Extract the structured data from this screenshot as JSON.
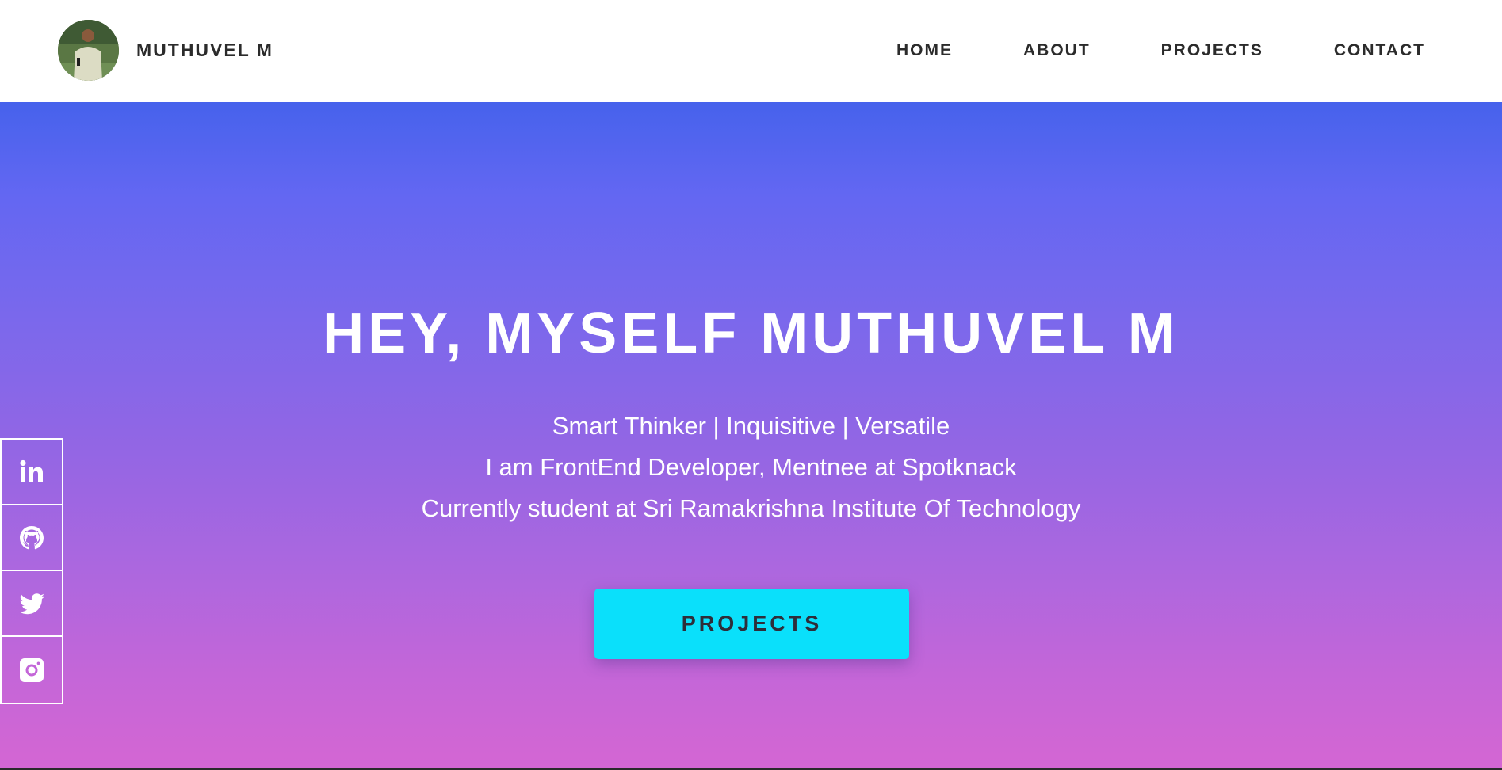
{
  "header": {
    "brand_name": "MUTHUVEL M",
    "avatar_icon": "profile-photo",
    "nav": [
      {
        "label": "HOME"
      },
      {
        "label": "ABOUT"
      },
      {
        "label": "PROJECTS"
      },
      {
        "label": "CONTACT"
      }
    ]
  },
  "hero": {
    "title": "HEY, MYSELF MUTHUVEL M",
    "lines": [
      "Smart Thinker | Inquisitive | Versatile",
      "I am FrontEnd Developer, Mentnee at Spotknack",
      "Currently student at Sri Ramakrishna Institute Of Technology"
    ],
    "cta_label": "PROJECTS"
  },
  "social": [
    {
      "icon": "linkedin-icon"
    },
    {
      "icon": "github-icon"
    },
    {
      "icon": "twitter-icon"
    },
    {
      "icon": "instagram-icon"
    }
  ],
  "colors": {
    "gradient_top": "#4662ec",
    "gradient_bottom": "#d466d3",
    "cta_background": "#0ae0fb",
    "text_dark": "#2b2b2b"
  }
}
